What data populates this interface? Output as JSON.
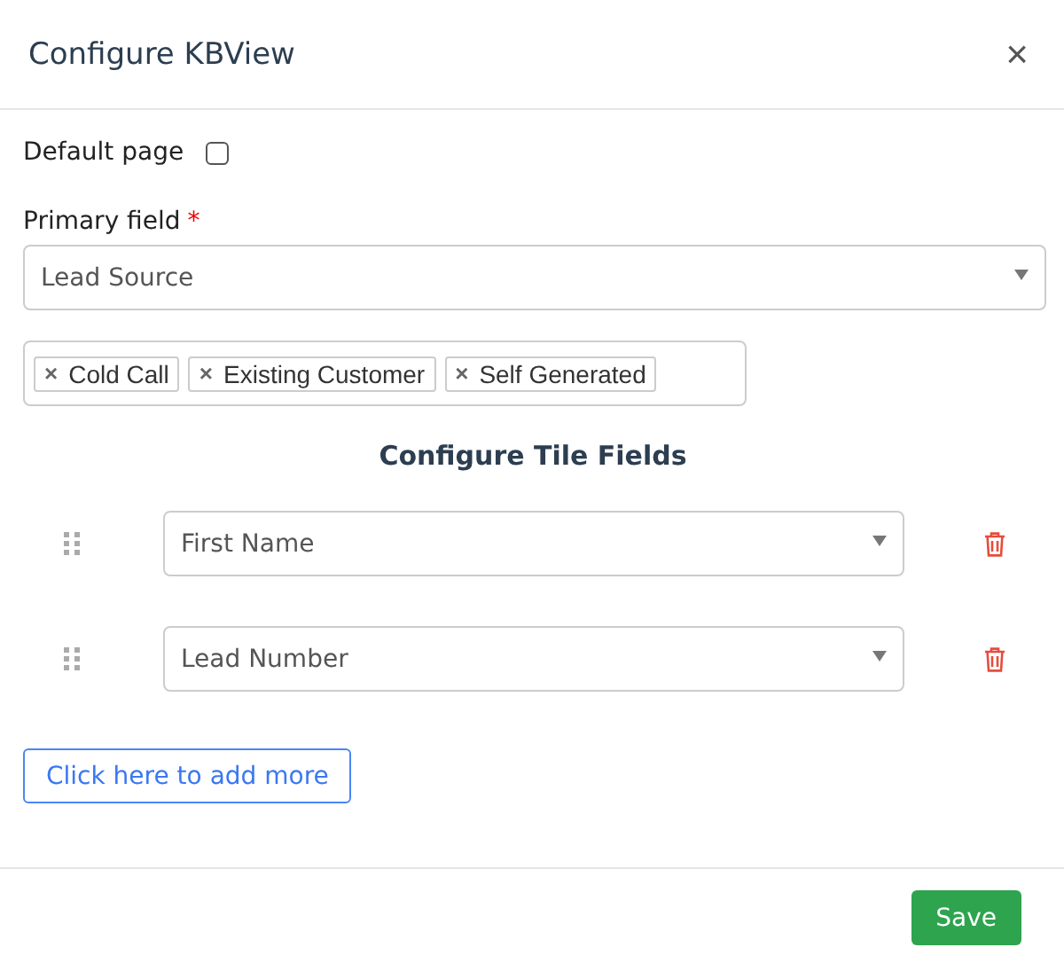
{
  "dialog": {
    "title": "Configure KBView",
    "close": "×"
  },
  "default_page": {
    "label": "Default page",
    "checked": false
  },
  "primary_field": {
    "label": "Primary field",
    "required_mark": "*",
    "value": "Lead Source"
  },
  "tags": [
    {
      "label": "Cold Call",
      "remove": "×"
    },
    {
      "label": "Existing Customer",
      "remove": "×"
    },
    {
      "label": "Self Generated",
      "remove": "×"
    }
  ],
  "tile_fields": {
    "heading": "Configure Tile Fields",
    "rows": [
      {
        "value": "First Name"
      },
      {
        "value": "Lead Number"
      }
    ]
  },
  "add_more": "Click here to add more",
  "buttons": [
    {
      "label": "Save",
      "kind": "primary"
    }
  ]
}
